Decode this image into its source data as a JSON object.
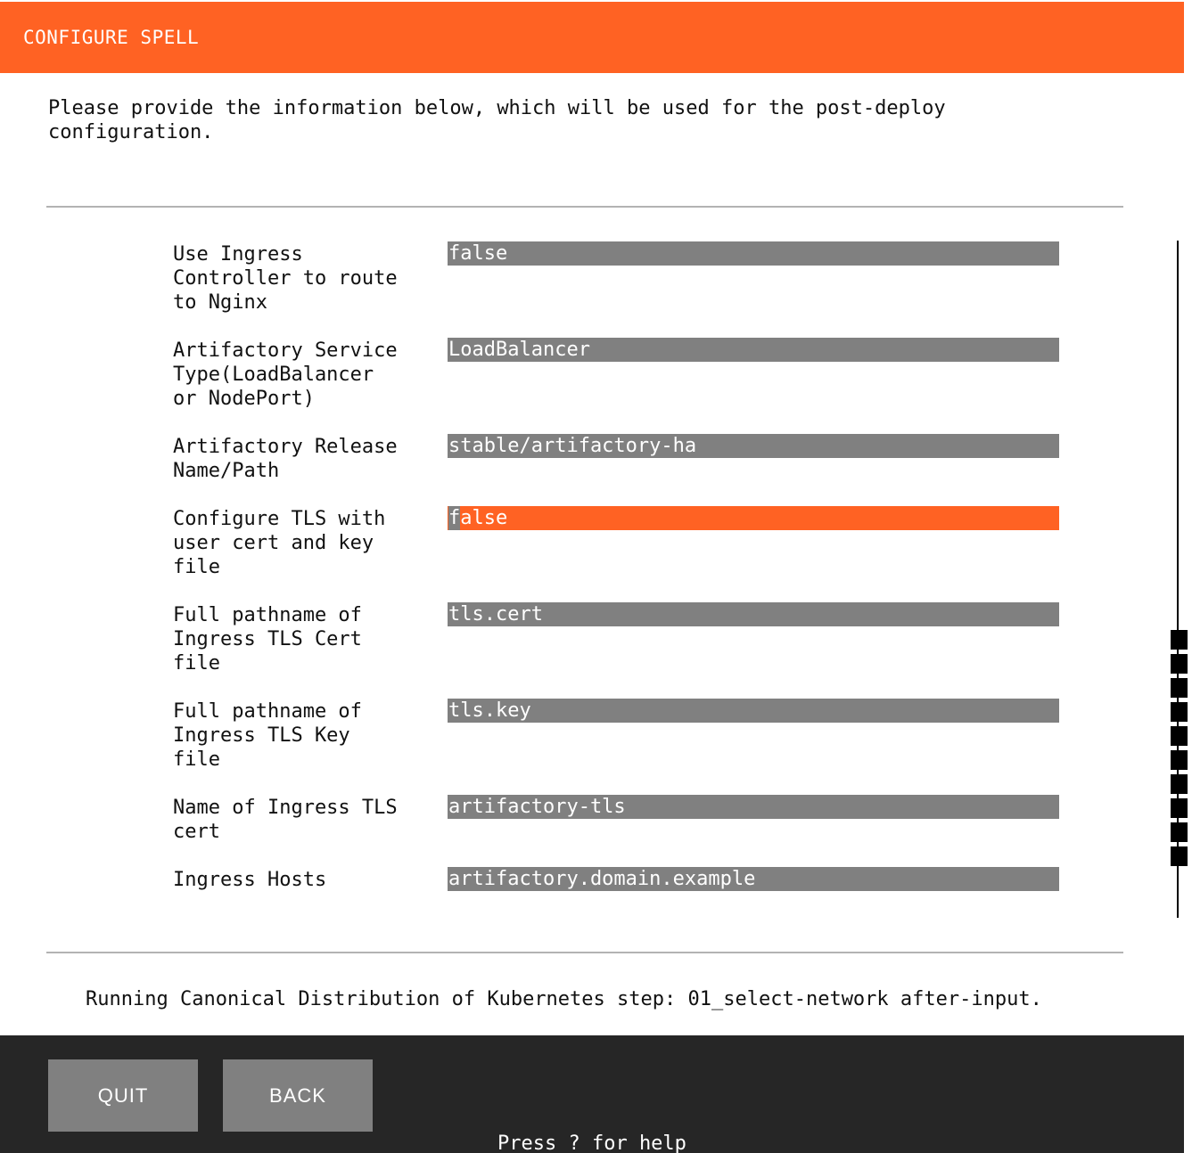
{
  "header": {
    "title": "CONFIGURE SPELL"
  },
  "intro": {
    "text": "Please provide the information below, which will be used for the post-deploy\nconfiguration."
  },
  "form": {
    "fields": [
      {
        "label": "Use Ingress\nController to route\nto Nginx",
        "value": "false"
      },
      {
        "label": "Artifactory Service\nType(LoadBalancer\nor NodePort)",
        "value": "LoadBalancer"
      },
      {
        "label": "Artifactory Release\nName/Path",
        "value": "stable/artifactory-ha"
      },
      {
        "label": "Configure TLS with\nuser cert and key\nfile",
        "value": "false",
        "value_head": "f",
        "value_rest": "alse",
        "focused": true
      },
      {
        "label": "Full pathname of\nIngress TLS Cert\nfile",
        "value": "tls.cert"
      },
      {
        "label": "Full pathname of\nIngress TLS Key\nfile",
        "value": "tls.key"
      },
      {
        "label": "Name of Ingress TLS\ncert",
        "value": "artifactory-tls"
      },
      {
        "label": "Ingress Hosts",
        "value": "artifactory.domain.example"
      }
    ]
  },
  "status": {
    "text": "Running Canonical Distribution of Kubernetes step: 01_select-network after-input."
  },
  "footer": {
    "quit_label": "QUIT",
    "back_label": "BACK",
    "help_text": "Press ? for help"
  },
  "colors": {
    "accent": "#ff6223",
    "field_bg": "#808080",
    "footer_bg": "#262626"
  }
}
